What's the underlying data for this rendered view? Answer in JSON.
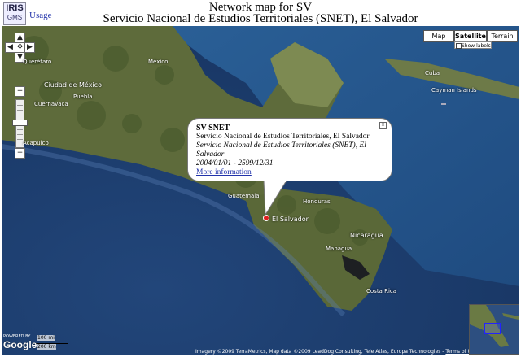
{
  "header": {
    "logo_line1": "IRIS",
    "logo_line2": "GMS",
    "usage_link": "Usage",
    "title": "Network map for SV",
    "subtitle": "Servicio Nacional de Estudios Territoriales (SNET), El Salvador"
  },
  "map_controls": {
    "pan_up": "▲",
    "pan_left": "◀",
    "pan_right": "▶",
    "pan_down": "▼",
    "pan_center": "✥",
    "zoom_in": "+",
    "zoom_out": "−",
    "zoom_level_fraction": 0.48
  },
  "map_types": {
    "map_label": "Map",
    "satellite_label": "Satellite",
    "terrain_label": "Terrain",
    "active": "Satellite",
    "show_labels": "Show labels",
    "show_labels_checked": true
  },
  "info_window": {
    "station": "SV SNET",
    "network_name": "Servicio Nacional de Estudios Territoriales, El Salvador",
    "operator": "Servicio Nacional de Estudios Territoriales (SNET), El Salvador",
    "dates": "2004/01/01 - 2599/12/31",
    "more_link": "More information",
    "close": "×"
  },
  "map_labels": {
    "queretaro": "Querétaro",
    "ciudad_mexico": "Ciudad de México",
    "puebla": "Puebla",
    "cuernavaca": "Cuernavaca",
    "acapulco": "Acapulco",
    "guatemala": "Guatemala",
    "honduras": "Honduras",
    "el_salvador": "El Salvador",
    "nicaragua": "Nicaragua",
    "managua": "Managua",
    "costa_rica": "Costa Rica",
    "cayman": "Cayman Islands",
    "mexico": "México",
    "cuba": "Cuba"
  },
  "scale": {
    "miles": "100 mi",
    "km": "200 km"
  },
  "footer": {
    "powered_by": "POWERED BY",
    "google": "Google",
    "copyright": "Imagery ©2009 TerraMetrics, Map data ©2009 LeadDog Consulting, Tele Atlas, Europa Technologies -",
    "terms": "Terms of Use"
  },
  "colors": {
    "ocean": "#1f3f6e",
    "land": "#5d6a3a",
    "link": "#2233aa",
    "marker": "#e02020"
  }
}
